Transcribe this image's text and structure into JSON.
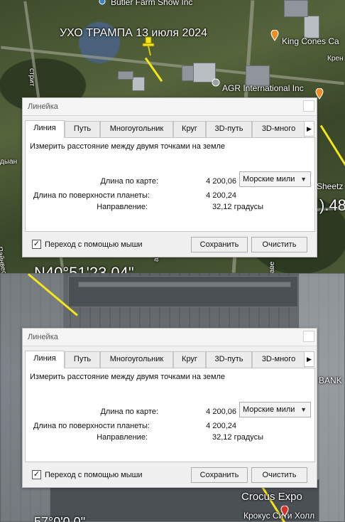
{
  "map_top": {
    "title": "УХО ТРАМПА 13 июля 2024",
    "places": {
      "butler": "Butler Farm Show Inc",
      "king_cones": "King Cones Ca",
      "king_cones_sub": "Крен",
      "agr": "AGR International Inc",
      "sheetz": "Sheetz",
      "street_left_1": "дыан",
      "street_left_2": "Пайнвеста",
      "street_mid": "аве",
      "street_right": "аве",
      "street_top_left": "стрит"
    },
    "coord_text": "N40°51'23.04\"",
    "coord_right": ").48"
  },
  "map_bottom": {
    "places": {
      "crocus": "Crocus Expo",
      "crocus_sub": "Крокус Сити Холл",
      "bank": "BANK",
      "coord_bottom": "57°0'0.0\""
    }
  },
  "ruler_top": {
    "title": "Линейка",
    "tabs": [
      "Линия",
      "Путь",
      "Многоугольник",
      "Круг",
      "3D-путь",
      "3D-много"
    ],
    "active_tab": "Линия",
    "description": "Измерить расстояние между двумя точками на земле",
    "map_length_label": "Длина по карте:",
    "map_length_value": "4 200,06",
    "unit": "Морские мили",
    "ground_length_label": "Длина по поверхности планеты:",
    "ground_length_value": "4 200,24",
    "heading_label": "Направление:",
    "heading_value": "32,12 градусы",
    "mouse_nav_label": "Переход с помощью мыши",
    "mouse_nav_checked": true,
    "save_label": "Сохранить",
    "clear_label": "Очистить"
  },
  "ruler_bottom": {
    "title": "Линейка",
    "tabs": [
      "Линия",
      "Путь",
      "Многоугольник",
      "Круг",
      "3D-путь",
      "3D-много"
    ],
    "active_tab": "Линия",
    "description": "Измерить расстояние между двумя точками на земле",
    "map_length_label": "Длина по карте:",
    "map_length_value": "4 200,06",
    "unit": "Морские мили",
    "ground_length_label": "Длина по поверхности планеты:",
    "ground_length_value": "4 200,24",
    "heading_label": "Направление:",
    "heading_value": "32,12 градусы",
    "mouse_nav_label": "Переход с помощью мыши",
    "mouse_nav_checked": true,
    "save_label": "Сохранить",
    "clear_label": "Очистить"
  },
  "icons": {
    "pushpin": "pushpin-icon",
    "place_pin": "place-pin-icon",
    "check": "checkmark-icon",
    "dropdown": "chevron-down-icon",
    "scroll_right": "chevron-right-icon"
  },
  "colors": {
    "ruler_line": "#f4e61b",
    "pushpin": "#f4e61b",
    "place_pin_orange": "#f08c1e",
    "place_pin_red": "#d93025"
  }
}
